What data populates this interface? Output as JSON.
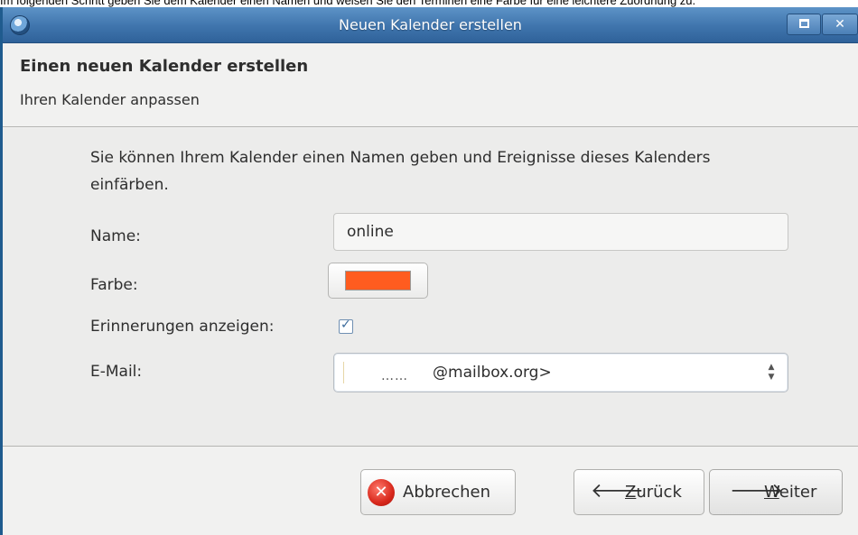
{
  "caption": "Im folgenden Schritt geben Sie dem Kalender einen Namen und weisen Sie den Terminen eine Farbe für eine leichtere Zuordnung zu.",
  "window": {
    "title": "Neuen Kalender erstellen",
    "maximize_glyph": "□",
    "close_glyph": "✕"
  },
  "header": {
    "title": "Einen neuen Kalender erstellen",
    "subtitle": "Ihren Kalender anpassen"
  },
  "form": {
    "intro": "Sie können Ihrem Kalender einen Namen geben und Ereignisse dieses Kalenders einfärben.",
    "name_label": "Name:",
    "name_value": "online",
    "color_label": "Farbe:",
    "color_value": "#ff5c1f",
    "reminders_label": "Erinnerungen anzeigen:",
    "reminders_checked": true,
    "email_label": "E-Mail:",
    "email_value_dots": "……",
    "email_value_domain": "@mailbox.org>"
  },
  "buttons": {
    "cancel_label": "Abbrechen",
    "back_mnemonic": "Z",
    "back_rest": "urück",
    "next_mnemonic": "W",
    "next_rest": "eiter"
  },
  "icons": {
    "app": "thunderbird-app-icon",
    "checkmark": "✓",
    "back_arrow": "🡐",
    "next_arrow": "🡒",
    "cancel": "✕",
    "spin_up": "▲",
    "spin_down": "▼"
  }
}
